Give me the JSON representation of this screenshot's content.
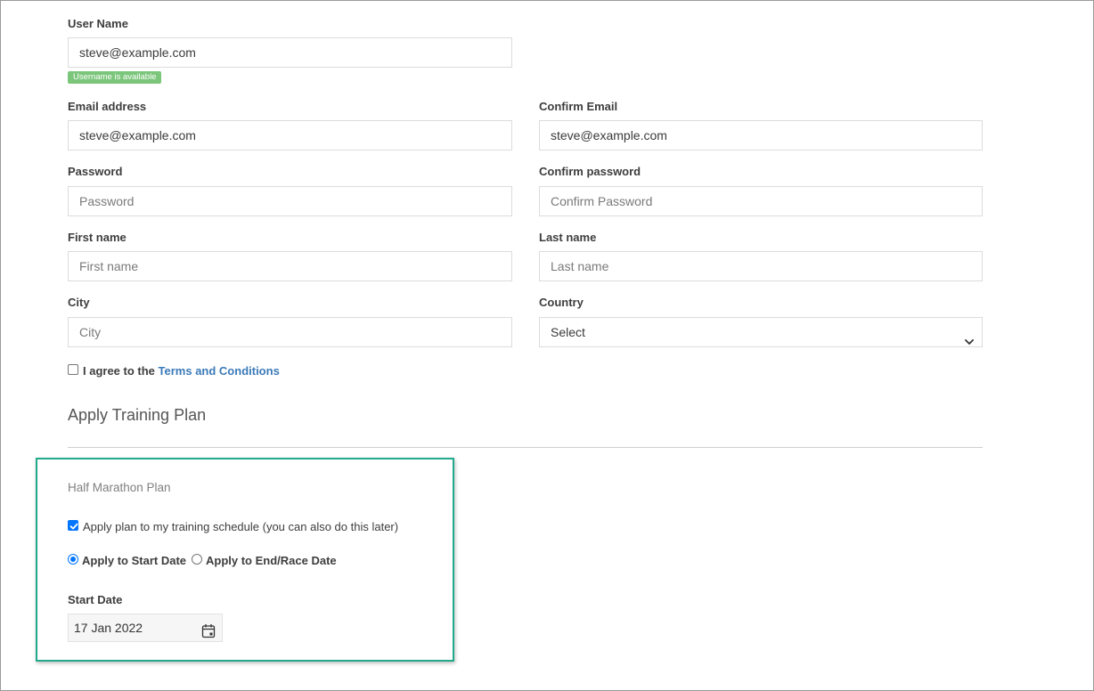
{
  "form": {
    "username": {
      "label": "User Name",
      "value": "steve@example.com",
      "status_badge": "Username is available"
    },
    "email": {
      "label": "Email address",
      "value": "steve@example.com"
    },
    "confirm_email": {
      "label": "Confirm Email",
      "value": "steve@example.com"
    },
    "password": {
      "label": "Password",
      "placeholder": "Password"
    },
    "confirm_password": {
      "label": "Confirm password",
      "placeholder": "Confirm Password"
    },
    "first_name": {
      "label": "First name",
      "placeholder": "First name"
    },
    "last_name": {
      "label": "Last name",
      "placeholder": "Last name"
    },
    "city": {
      "label": "City",
      "placeholder": "City"
    },
    "country": {
      "label": "Country",
      "selected": "Select"
    },
    "terms": {
      "prefix": "I agree to the ",
      "link": "Terms and Conditions",
      "checked": false
    }
  },
  "training": {
    "heading": "Apply Training Plan",
    "plan_name": "Half Marathon Plan",
    "apply_checkbox": {
      "label": "Apply plan to my training schedule (you can also do this later)",
      "checked": true
    },
    "radio_start": {
      "label": "Apply to Start Date",
      "checked": true
    },
    "radio_end": {
      "label": "Apply to End/Race Date",
      "checked": false
    },
    "start_date": {
      "label": "Start Date",
      "value": "17 Jan 2022",
      "icon": "calendar-icon"
    }
  },
  "colors": {
    "badge_green": "#7cc67c",
    "link_blue": "#3b7ab8",
    "highlight_border": "#21a98a",
    "checkbox_blue": "#0075ff"
  }
}
